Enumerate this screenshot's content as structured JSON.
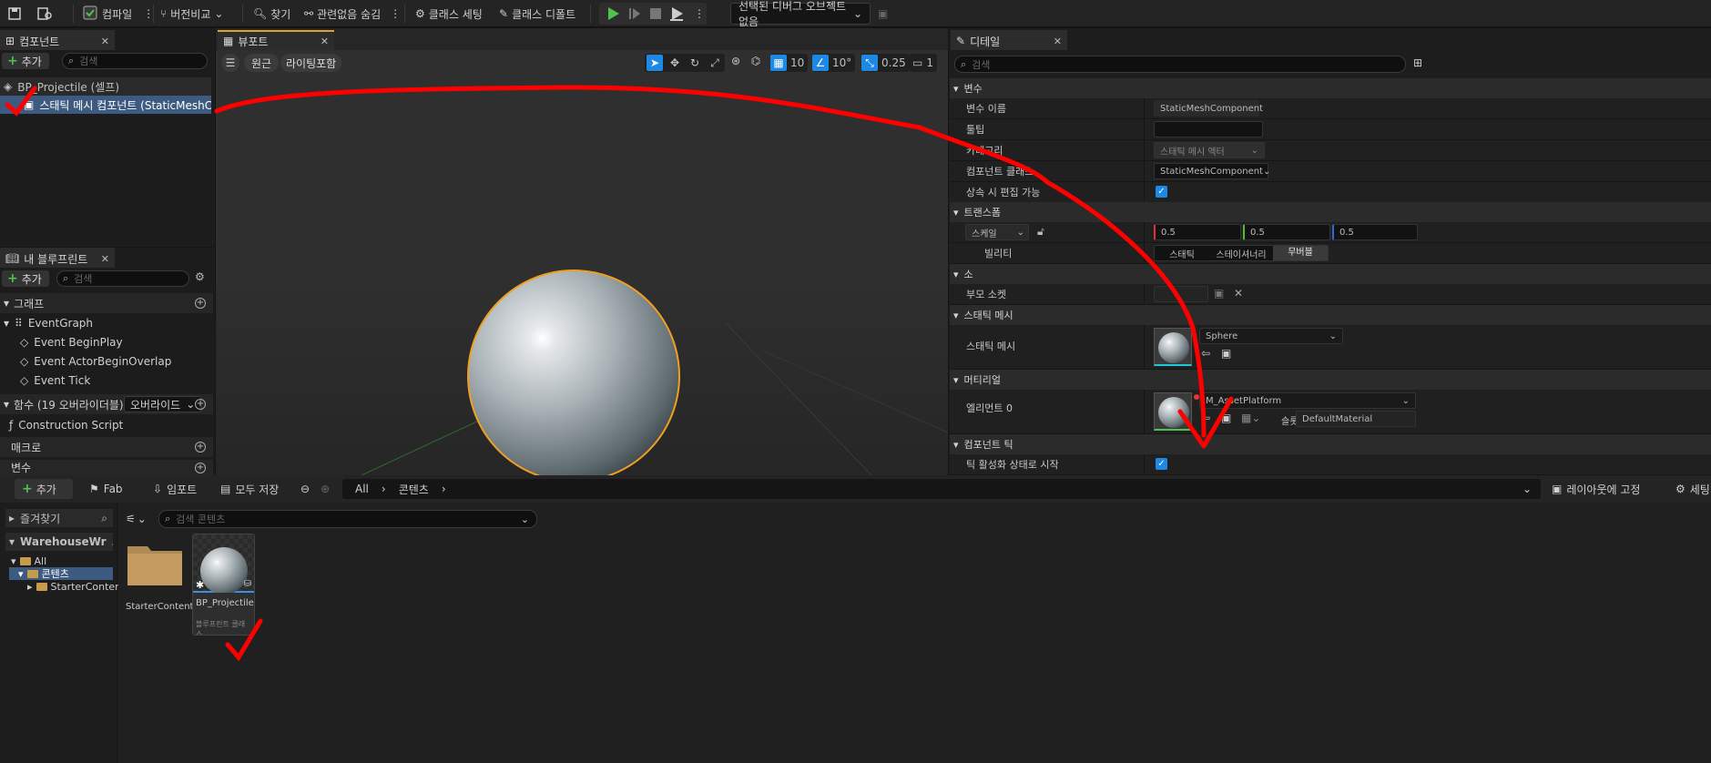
{
  "toolbar": {
    "compile_label": "컴파일",
    "diff_label": "버전비교",
    "find_label": "찾기",
    "hide_unrelated_label": "관련없음 숨김",
    "class_settings_label": "클래스 세팅",
    "class_defaults_label": "클래스 디폴트",
    "debug_object_label": "선택된 디버그 오브젝트 없음"
  },
  "components_panel": {
    "tab_label": "컴포넌트",
    "add_label": "추가",
    "search_placeholder": "검색",
    "items": [
      {
        "label": "BP_Projectile (셀프)"
      },
      {
        "label": "스태틱 메시 컴포넌트 (StaticMeshCompo"
      }
    ]
  },
  "viewport": {
    "tab_label": "뷰포트",
    "perspective_label": "원근",
    "lighting_label": "라이팅포함",
    "grid_value": "10",
    "angle_value": "10°",
    "scale_value": "0.25",
    "camera_value": "1"
  },
  "my_blueprint": {
    "tab_label": "내 블루프린트",
    "add_label": "추가",
    "search_placeholder": "검색",
    "graph_section": "그래프",
    "event_graph": "EventGraph",
    "events": [
      "Event BeginPlay",
      "Event ActorBeginOverlap",
      "Event Tick"
    ],
    "functions_section": "함수 (19 오버라이더블)",
    "override_label": "오버라이드",
    "construction_script": "Construction Script",
    "macros_section": "매크로",
    "variables_section": "변수"
  },
  "details": {
    "tab_label": "디테일",
    "search_placeholder": "검색",
    "sections": {
      "variable": "변수",
      "transform": "트랜스폼",
      "sockets": "소",
      "static_mesh": "스태틱 메시",
      "materials": "머티리얼",
      "component_tick": "컴포넌트 틱"
    },
    "rows": {
      "variable_name_label": "변수 이름",
      "variable_name_value": "StaticMeshComponent",
      "tooltip_label": "툴팁",
      "category_label": "카테고리",
      "category_value": "스태틱 메시 액터",
      "component_class_label": "컴포넌트 클래스",
      "component_class_value": "StaticMeshComponent",
      "editable_label": "상속 시 편집 가능",
      "scale_label": "스케일",
      "scale_x": "0.5",
      "scale_y": "0.5",
      "scale_z": "0.5",
      "mobility_label": "빌리티",
      "mobility_static": "스태틱",
      "mobility_stationary": "스테이셔너리",
      "mobility_movable": "무버블",
      "parent_socket_label": "부모 소켓",
      "static_mesh_label": "스태틱 메시",
      "static_mesh_value": "Sphere",
      "element0_label": "엘리먼트 0",
      "material_value": "M_AssetPlatform",
      "slot_label": "슬롯",
      "slot_value": "DefaultMaterial",
      "tick_label": "틱 활성화 상태로 시작"
    }
  },
  "content_browser": {
    "add_label": "추가",
    "fab_label": "Fab",
    "import_label": "임포트",
    "save_all_label": "모두 저장",
    "path": [
      "All",
      "콘텐츠"
    ],
    "lock_layout_label": "레이아웃에 고정",
    "settings_label": "세팅",
    "favorites_label": "즐겨찾기",
    "project_label": "WarehouseWr",
    "search_placeholder": "검색 콘텐츠",
    "tree": [
      "All",
      "콘텐츠",
      "StarterContent"
    ],
    "assets": [
      {
        "name": "StarterContent",
        "type": ""
      },
      {
        "name": "BP_Projectile",
        "type": "블루프린트 클래스"
      }
    ]
  },
  "colors": {
    "accent_blue": "#1e88e5",
    "selection_orange": "#f0a020",
    "annotation_red": "#ff0000",
    "play_green": "#4ec34e"
  }
}
